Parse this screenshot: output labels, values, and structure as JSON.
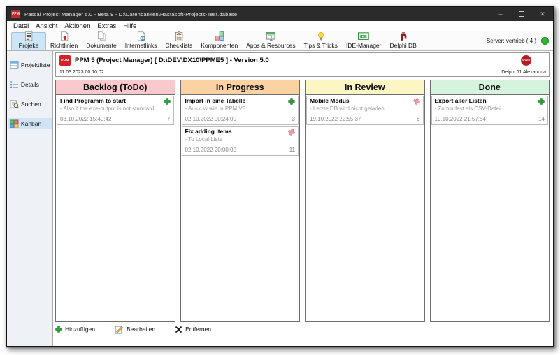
{
  "window": {
    "title": "Pascal Project Manager 5.0 - Beta 9 - D:\\Datenbanken\\Hastasoft-Projects-Test.dabase",
    "app_icon": "PPM"
  },
  "menu": {
    "items": [
      {
        "label": "Datei",
        "accel_index": 0
      },
      {
        "label": "Ansicht",
        "accel_index": 0
      },
      {
        "label": "Aktionen",
        "accel_index": 1
      },
      {
        "label": "Extras",
        "accel_index": 1
      },
      {
        "label": "Hilfe",
        "accel_index": 0
      }
    ]
  },
  "toolbar": {
    "items": [
      {
        "label": "Projeke",
        "icon": "report-icon",
        "selected": true
      },
      {
        "label": "Richtlinien",
        "icon": "document-seal-icon",
        "selected": false
      },
      {
        "label": "Dokumente",
        "icon": "documents-icon",
        "selected": false
      },
      {
        "label": "Internetlinks",
        "icon": "document-globe-icon",
        "selected": false
      },
      {
        "label": "Checklists",
        "icon": "clipboard-icon",
        "selected": false
      },
      {
        "label": "Komponenten",
        "icon": "components-icon",
        "selected": false
      },
      {
        "label": "Apps & Resources",
        "icon": "apps-icon",
        "selected": false
      },
      {
        "label": "Tips & Tricks",
        "icon": "lightbulb-icon",
        "selected": false
      },
      {
        "label": "IDE-Manager",
        "icon": "ide-icon",
        "selected": false
      },
      {
        "label": "Delphi DB",
        "icon": "delphi-helmet-icon",
        "selected": false
      }
    ],
    "server_label": "Server: vertrieb ( 4 )",
    "server_status_color": "#2eb82e"
  },
  "sidebar": {
    "items": [
      {
        "label": "Projektliste",
        "icon": "project-list-icon",
        "selected": false
      },
      {
        "label": "Details",
        "icon": "details-icon",
        "selected": false
      },
      {
        "label": "Suchen",
        "icon": "search-icon",
        "selected": false
      },
      {
        "label": "Kanban",
        "icon": "kanban-icon",
        "selected": true
      }
    ]
  },
  "header": {
    "logo": "PPM",
    "title": "PPM 5 (Project Manager) [ D:\\DEV\\DX10\\PPME5 ]  - Version 5.0",
    "timestamp": "11.03.2023 00:10:02",
    "badge": "RAD",
    "edition": "Delphi 11 Alexandria"
  },
  "board": {
    "columns": [
      {
        "title": "Backlog (ToDo)",
        "color": "#f9c9cd",
        "cards": [
          {
            "title": "Find Programm to start",
            "subtitle": "- Also if the exe-output is not standard",
            "date": "03.10.2022 15:40:42",
            "count": "7",
            "pin": "green"
          }
        ]
      },
      {
        "title": "In Progress",
        "color": "#fbd3a2",
        "cards": [
          {
            "title": "Import in eine Tabelle",
            "subtitle": "- Aus csv wie in PPM V5",
            "date": "02.10.2022 00:24:00",
            "count": "3",
            "pin": "green"
          },
          {
            "title": "Fix adding items",
            "subtitle": "- To Local Lists",
            "date": "02.10.2022 20:00:00",
            "count": "11",
            "pin": "red"
          }
        ]
      },
      {
        "title": "In Review",
        "color": "#fbf6c3",
        "cards": [
          {
            "title": "Mobile Modus",
            "subtitle": "- Letzte DB wird nicht geladen",
            "date": "19.10.2022 22:55:37",
            "count": "6",
            "pin": "red"
          }
        ]
      },
      {
        "title": "Done",
        "color": "#d6f3dd",
        "cards": [
          {
            "title": "Export aller Listen",
            "subtitle": "- Zumindest als CSV-Datei",
            "date": "19.10.2022 21:57:54",
            "count": "14",
            "pin": "green"
          }
        ]
      }
    ]
  },
  "actions": {
    "add": "Hinzufügen",
    "edit": "Bearbeiten",
    "remove": "Entfernen"
  },
  "window_controls": {
    "minimize": "–",
    "maximize": "▫",
    "close": "✕"
  }
}
